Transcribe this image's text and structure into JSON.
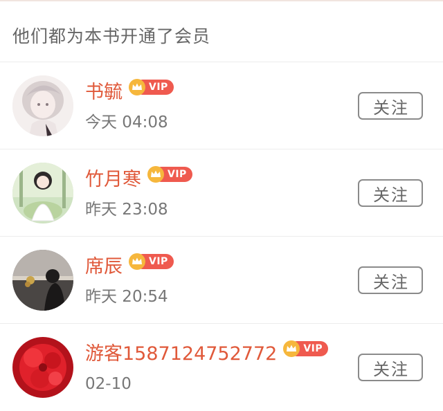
{
  "header": {
    "title": "他们都为本书开通了会员"
  },
  "colors": {
    "username": "#e0593a",
    "vip_badge": "#ef5a4f",
    "crown": "#f6b73c"
  },
  "members": [
    {
      "name": "书毓",
      "vip": "VIP",
      "time": "今天 04:08",
      "follow_label": "关注",
      "avatar_icon": "anime-girl-avatar"
    },
    {
      "name": "竹月寒",
      "vip": "VIP",
      "time": "昨天 23:08",
      "follow_label": "关注",
      "avatar_icon": "cartoon-bride-avatar"
    },
    {
      "name": "席辰",
      "vip": "VIP",
      "time": "昨天 20:54",
      "follow_label": "关注",
      "avatar_icon": "girl-with-flowers-avatar"
    },
    {
      "name": "游客1587124752772",
      "vip": "VIP",
      "time": "02-10",
      "follow_label": "关注",
      "avatar_icon": "red-flower-avatar"
    }
  ]
}
